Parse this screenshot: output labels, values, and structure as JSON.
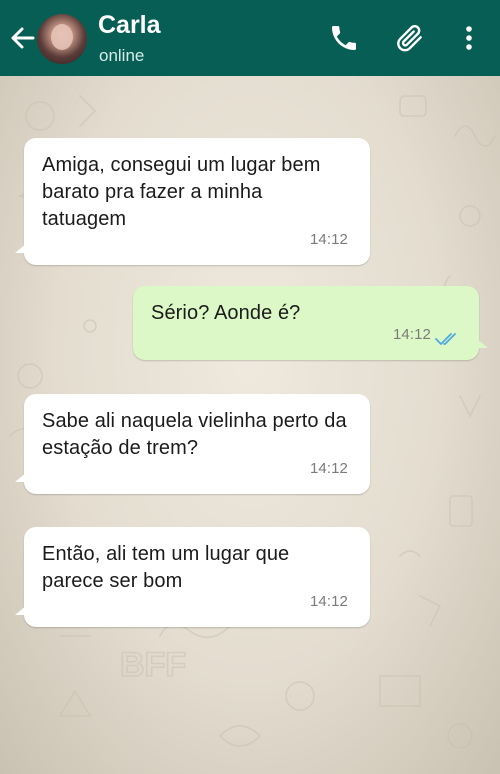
{
  "header": {
    "contact_name": "Carla",
    "status": "online",
    "background_color": "#075e54",
    "icons": [
      "back-arrow-icon",
      "phone-icon",
      "attachment-icon",
      "more-vertical-icon"
    ]
  },
  "messages": [
    {
      "direction": "incoming",
      "text": "Amiga, consegui um lugar bem barato pra fazer a minha tatuagem",
      "time": "14:12"
    },
    {
      "direction": "outgoing",
      "text": "Sério? Aonde é?",
      "time": "14:12",
      "status": "read"
    },
    {
      "direction": "incoming",
      "text": "Sabe ali naquela vielinha perto da estação de trem?",
      "time": "14:12"
    },
    {
      "direction": "incoming",
      "text": "Então, ali tem um lugar que parece ser bom",
      "time": "14:12"
    }
  ],
  "colors": {
    "incoming_bubble": "#ffffff",
    "outgoing_bubble": "#dcf8c6",
    "read_ticks": "#4fa9e0"
  }
}
